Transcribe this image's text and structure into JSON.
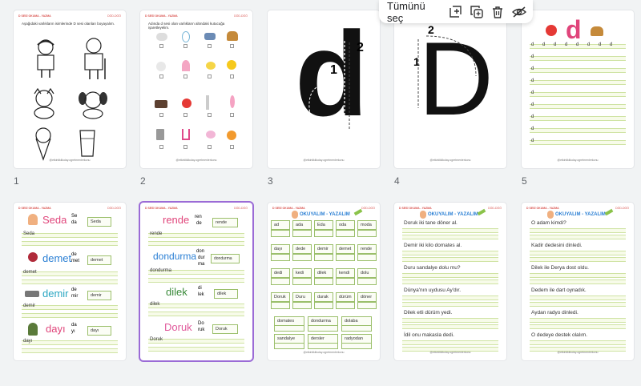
{
  "toolbar": {
    "select_all_label": "Tümünü seç",
    "icons": [
      "add-page-icon",
      "duplicate-icon",
      "delete-icon",
      "hide-icon"
    ]
  },
  "page_header": {
    "left": "D SESİ OKUMA - YAZMA",
    "right": "DÖD-DÖÖ"
  },
  "footer_credit": "@etkinliklikolay.ogretmenlerkonu",
  "pages": [
    {
      "number": "1",
      "instruction": "Aşağıdaki varlıkların isimlerinde D sesi olanları boyayalım."
    },
    {
      "number": "2",
      "instruction": "Adında d sesi olan varlıkların altındaki kutucuğa işaretleyelim."
    },
    {
      "number": "3",
      "letter": "d",
      "stroke1": "1",
      "stroke2": "2"
    },
    {
      "number": "4",
      "letter": "D",
      "stroke1": "1",
      "stroke2": "2"
    },
    {
      "number": "5",
      "letter": "d",
      "row_letter": "d"
    },
    {
      "number": "6",
      "words": [
        {
          "word": "Seda",
          "syl1": "Se",
          "syl2": "da",
          "answer": "Seda",
          "line": "Seda",
          "color": "#e0457b"
        },
        {
          "word": "demet",
          "syl1": "de",
          "syl2": "met",
          "answer": "demet",
          "line": "demet",
          "color": "#2a7fd4"
        },
        {
          "word": "demir",
          "syl1": "de",
          "syl2": "mir",
          "answer": "demir",
          "line": "demir",
          "color": "#2aa6c2"
        },
        {
          "word": "dayı",
          "syl1": "da",
          "syl2": "yı",
          "answer": "dayı",
          "line": "dayı",
          "color": "#e0457b"
        }
      ]
    },
    {
      "number": "7",
      "words": [
        {
          "word": "rende",
          "syl1": "ren",
          "syl2": "de",
          "answer": "rende",
          "line": "rende",
          "color": "#e0457b"
        },
        {
          "word": "dondurma",
          "syl1": "don",
          "syl2": "dur",
          "syl3": "ma",
          "answer": "dondurma",
          "line": "dondurma",
          "color": "#2a7fd4"
        },
        {
          "word": "dilek",
          "syl1": "di",
          "syl2": "lek",
          "answer": "dilek",
          "line": "dilek",
          "color": "#3a8a3a"
        },
        {
          "word": "Doruk",
          "syl1": "Do",
          "syl2": "ruk",
          "answer": "Doruk",
          "line": "Doruk",
          "color": "#e05a9b"
        }
      ]
    },
    {
      "number": "8",
      "title": "OKUYALIM - YAZALIM",
      "rows": [
        [
          "ad",
          "ada",
          "Eda",
          "oda",
          "moda"
        ],
        [
          "dayı",
          "dede",
          "demir",
          "demet",
          "rende"
        ],
        [
          "dedi",
          "kedi",
          "dilek",
          "kendi",
          "dolu"
        ],
        [
          "Doruk",
          "Duru",
          "durak",
          "dürüm",
          "döner"
        ]
      ],
      "extra": [
        [
          "domates",
          "dondurma",
          "dolaba"
        ],
        [
          "sandalye",
          "dersler",
          "radyodan"
        ]
      ]
    },
    {
      "number": "9",
      "title": "OKUYALIM - YAZALIM",
      "sentences": [
        "Doruk iki tane döner al.",
        "Demir iki kilo domates al.",
        "Duru sandalye dolu mu?",
        "Dünya'nın uydusu Ay'dır.",
        "Dilek etli dürüm yedi.",
        "İdil onu makasla dedi."
      ]
    },
    {
      "number": "10",
      "title": "OKUYALIM - YAZALIM",
      "sentences": [
        "O adam kimdi?",
        "Kadir dedesini dinledi.",
        "Dilek ile Derya dost oldu.",
        "Dedem ile dart oynadık.",
        "Aydan radyo dinledi.",
        "O dedeye destek olalım."
      ]
    }
  ]
}
